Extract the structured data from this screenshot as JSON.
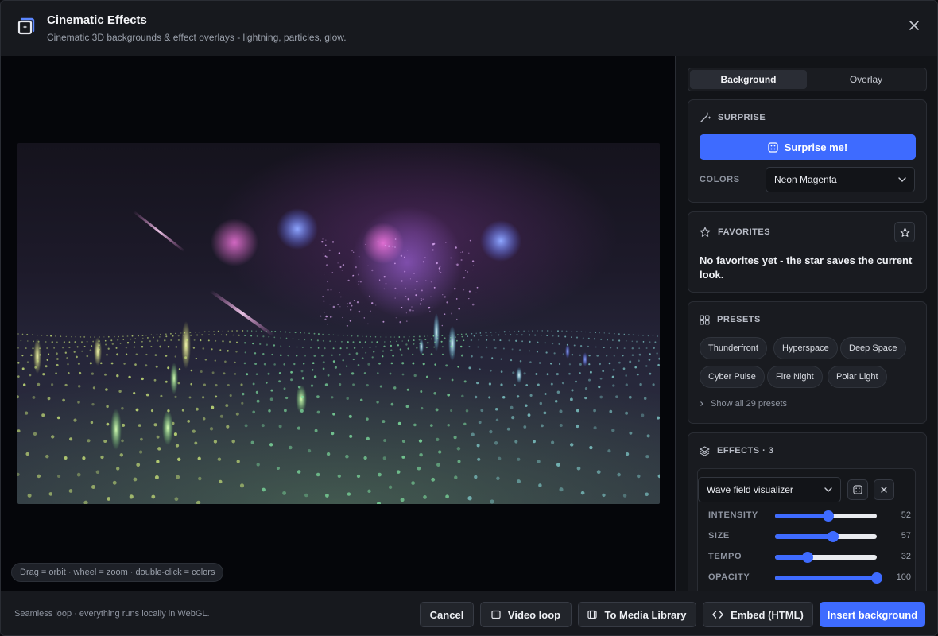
{
  "header": {
    "title": "Cinematic Effects",
    "subtitle": "Cinematic 3D backgrounds & effect overlays - lightning, particles, glow.",
    "close_icon": "close-icon",
    "logo_icon": "sparkle-frame-icon"
  },
  "preview": {
    "hint": "Drag = orbit · wheel = zoom · double-click = colors"
  },
  "tabs": [
    {
      "label": "Background",
      "active": true
    },
    {
      "label": "Overlay",
      "active": false
    }
  ],
  "surprise": {
    "heading": "SURPRISE",
    "button_label": "Surprise me!",
    "colors_label": "COLORS",
    "colors_value": "Neon Magenta"
  },
  "favorites": {
    "heading": "FAVORITES",
    "empty_text": "No favorites yet - the star saves the current look."
  },
  "presets": {
    "heading": "PRESETS",
    "items": [
      "Thunderfront",
      "Hyperspace",
      "Deep Space",
      "Cyber Pulse",
      "Fire Night",
      "Polar Light"
    ],
    "show_all": "Show all 29 presets"
  },
  "effects": {
    "heading": "EFFECTS · 3",
    "selected_effect": "Wave field visualizer",
    "sliders": [
      {
        "label": "INTENSITY",
        "value": 52
      },
      {
        "label": "SIZE",
        "value": 57
      },
      {
        "label": "TEMPO",
        "value": 32
      },
      {
        "label": "OPACITY",
        "value": 100
      }
    ]
  },
  "footer": {
    "note": "Seamless loop · everything runs locally in WebGL.",
    "cancel": "Cancel",
    "video_loop": "Video loop",
    "media_library": "To Media Library",
    "embed": "Embed (HTML)",
    "insert": "Insert background"
  },
  "colors": {
    "accent": "#3e6bff",
    "background": "#17191e",
    "panel": "#121418"
  }
}
